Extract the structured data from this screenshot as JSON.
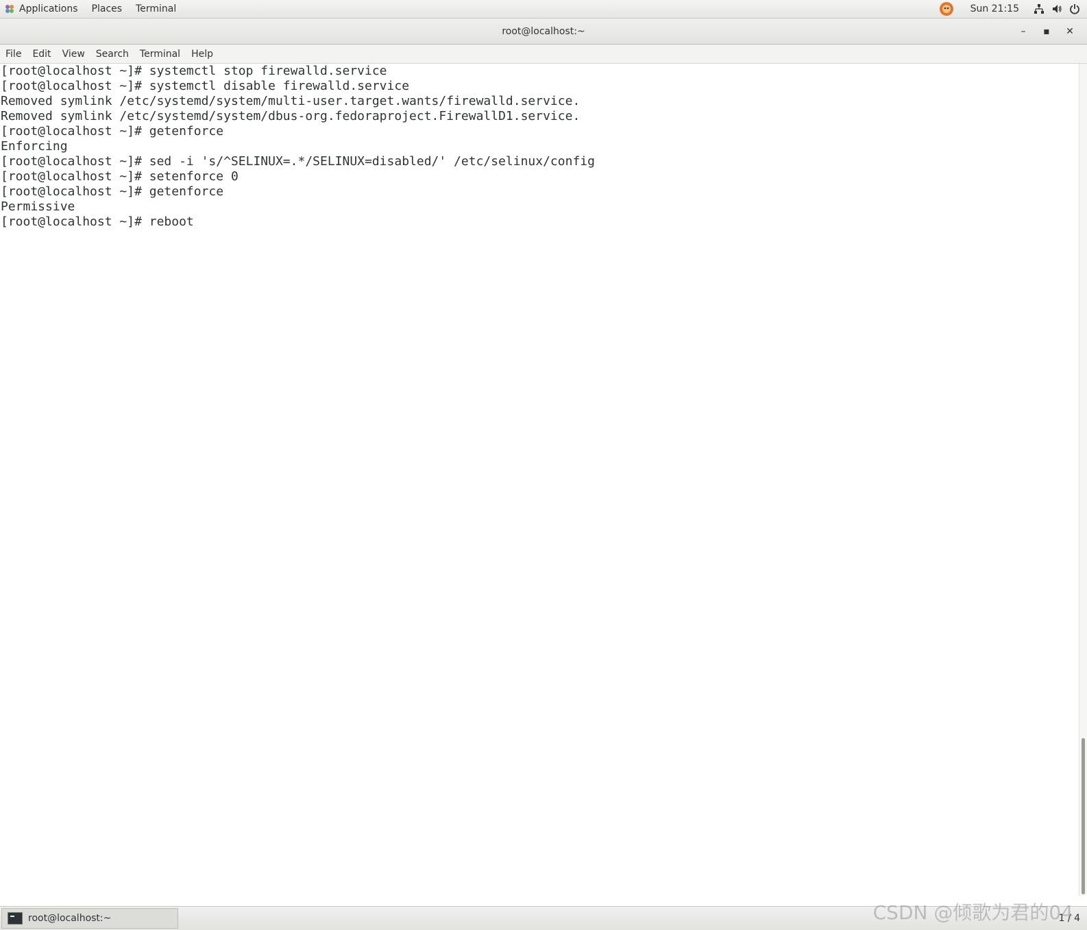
{
  "top_panel": {
    "applications": "Applications",
    "places": "Places",
    "terminal": "Terminal",
    "clock": "Sun 21:15"
  },
  "window": {
    "title": "root@localhost:~",
    "minimize": "–",
    "maximize": "▪",
    "close": "✕"
  },
  "menubar": {
    "items": [
      "File",
      "Edit",
      "View",
      "Search",
      "Terminal",
      "Help"
    ]
  },
  "terminal": {
    "lines": [
      "[root@localhost ~]# systemctl stop firewalld.service",
      "[root@localhost ~]# systemctl disable firewalld.service",
      "Removed symlink /etc/systemd/system/multi-user.target.wants/firewalld.service.",
      "Removed symlink /etc/systemd/system/dbus-org.fedoraproject.FirewallD1.service.",
      "[root@localhost ~]# getenforce",
      "Enforcing",
      "[root@localhost ~]# sed -i 's/^SELINUX=.*/SELINUX=disabled/' /etc/selinux/config",
      "[root@localhost ~]# setenforce 0",
      "[root@localhost ~]# getenforce",
      "Permissive",
      "[root@localhost ~]# reboot"
    ]
  },
  "taskbar": {
    "task_label": "root@localhost:~",
    "pager": "1 / 4"
  },
  "watermark": "CSDN @倾歌为君的04",
  "icons": {
    "apps": "apps-icon",
    "avatar": "user-avatar-icon",
    "network": "network-icon",
    "volume": "volume-icon",
    "power": "power-icon"
  }
}
